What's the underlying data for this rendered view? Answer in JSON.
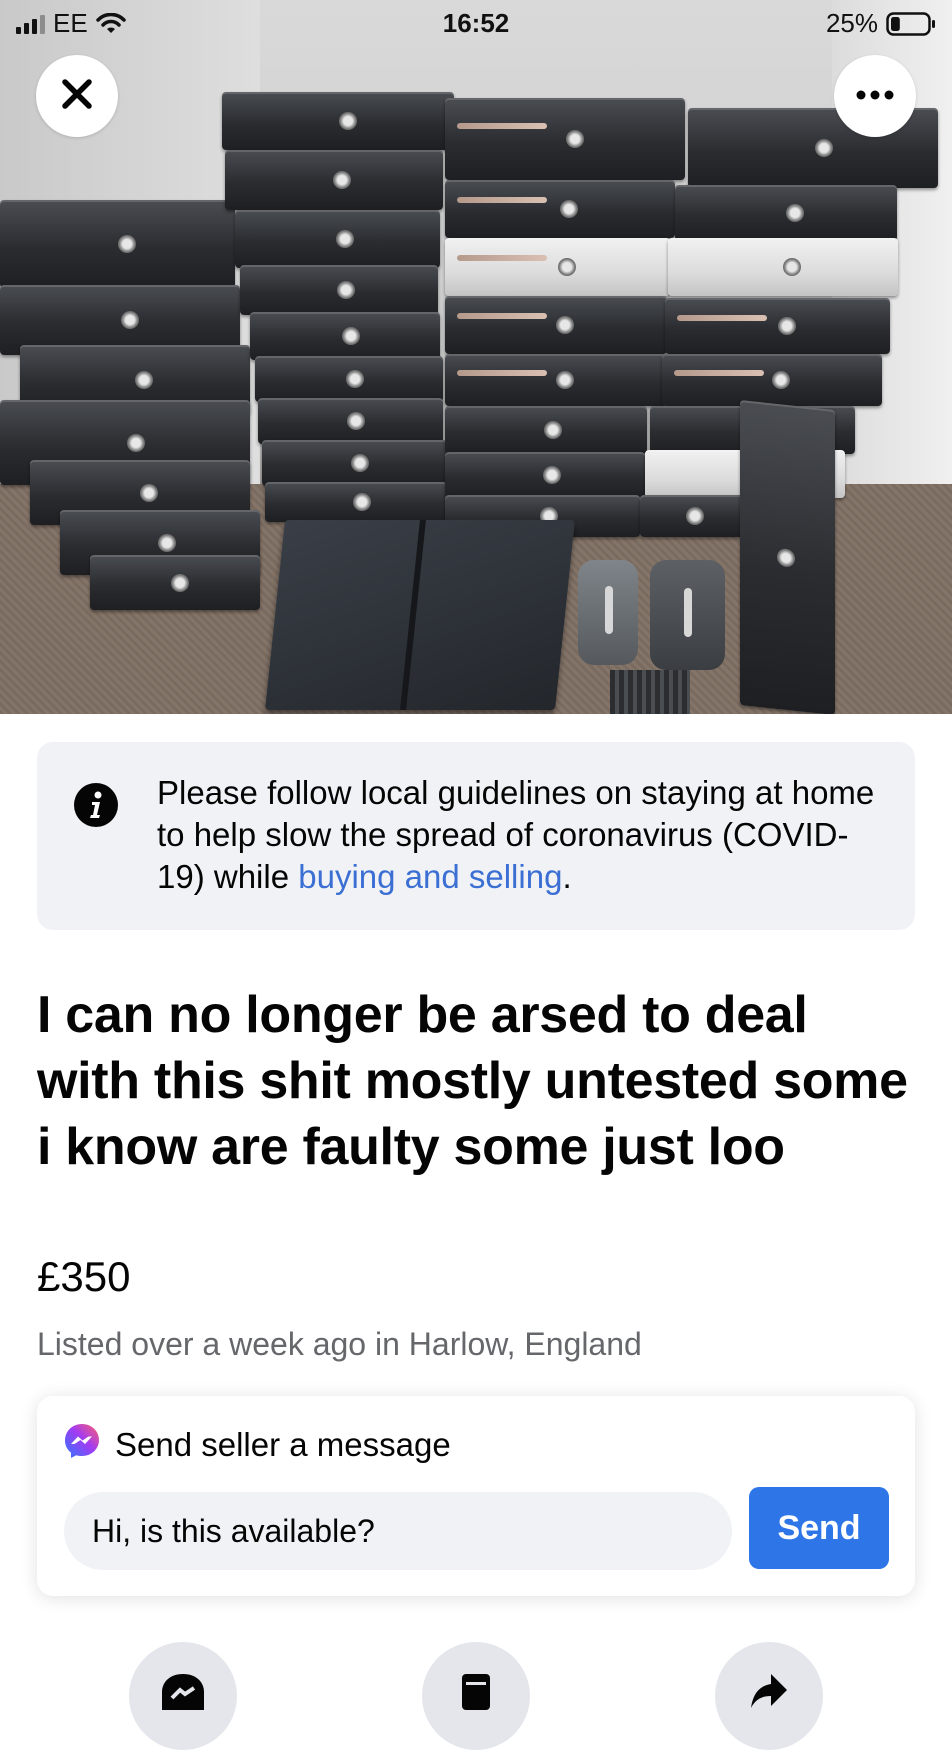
{
  "status_bar": {
    "carrier": "EE",
    "time": "16:52",
    "battery_percent": "25%",
    "battery_level": 0.25
  },
  "photo": {
    "close_icon": "close-icon",
    "more_icon": "more-horizontal-icon"
  },
  "notice": {
    "icon": "info-icon",
    "text_before_link": "Please follow local guidelines on staying at home to help slow the spread of coronavirus (COVID-19) while ",
    "link_text": "buying and selling",
    "text_after_link": "."
  },
  "listing": {
    "title": "I can no longer be arsed to deal with this shit mostly untested some i know are faulty some just loo",
    "price": "£350",
    "meta": "Listed over a week ago in Harlow, England"
  },
  "message_card": {
    "icon": "messenger-icon",
    "heading": "Send seller a message",
    "input_value": "Hi, is this available?",
    "send_label": "Send"
  },
  "actions": [
    {
      "icon": "message-icon"
    },
    {
      "icon": "save-icon"
    },
    {
      "icon": "share-icon"
    }
  ],
  "colors": {
    "link": "#3b6fd4",
    "send_button": "#2e76e8",
    "notice_bg": "#f0f2f5",
    "meta_text": "#65676b"
  }
}
